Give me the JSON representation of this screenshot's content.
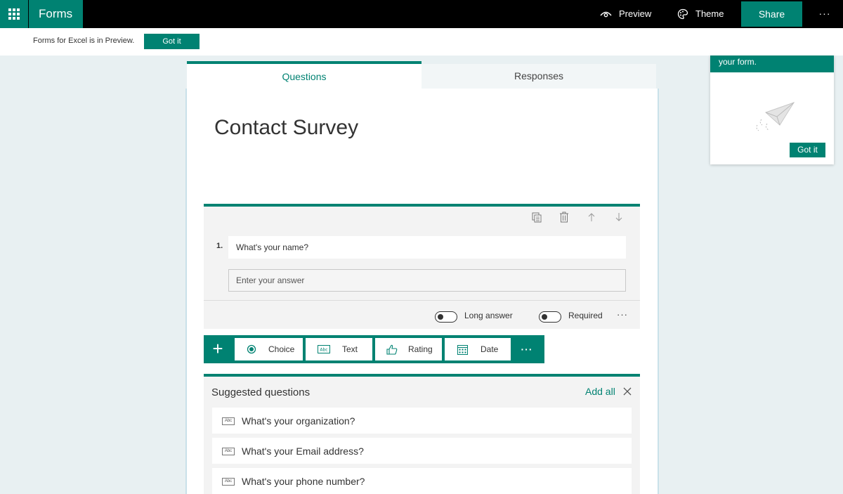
{
  "app": {
    "name": "Forms"
  },
  "topbar": {
    "preview_label": "Preview",
    "theme_label": "Theme",
    "share_label": "Share",
    "more_label": "···"
  },
  "banner": {
    "text": "Forms for Excel is in Preview.",
    "button_label": "Got it"
  },
  "tabs": [
    {
      "label": "Questions",
      "active": true
    },
    {
      "label": "Responses",
      "active": false
    }
  ],
  "form": {
    "title": "Contact Survey"
  },
  "question": {
    "number": "1.",
    "text": "What's your name?",
    "answer_placeholder": "Enter your answer",
    "long_answer_label": "Long answer",
    "required_label": "Required",
    "more_label": "···",
    "tools": [
      "copy-icon",
      "delete-icon",
      "arrow-up-icon",
      "arrow-down-icon"
    ]
  },
  "add_bar": {
    "plus_label": "+",
    "types": [
      {
        "label": "Choice",
        "icon": "radio-icon"
      },
      {
        "label": "Text",
        "icon": "text-abc-icon"
      },
      {
        "label": "Rating",
        "icon": "thumbs-up-icon"
      },
      {
        "label": "Date",
        "icon": "calendar-icon"
      }
    ],
    "more_label": "···"
  },
  "suggested": {
    "title": "Suggested questions",
    "add_all_label": "Add all",
    "items": [
      {
        "label": "What's your organization?"
      },
      {
        "label": "What's your Email address?"
      },
      {
        "label": "What's your phone number?"
      }
    ],
    "abc_label": "Abc"
  },
  "popup": {
    "header_text": "your form.",
    "button_label": "Got it"
  },
  "colors": {
    "accent": "#008272",
    "topbar": "#000000",
    "page_bg": "#e8f0f2"
  }
}
